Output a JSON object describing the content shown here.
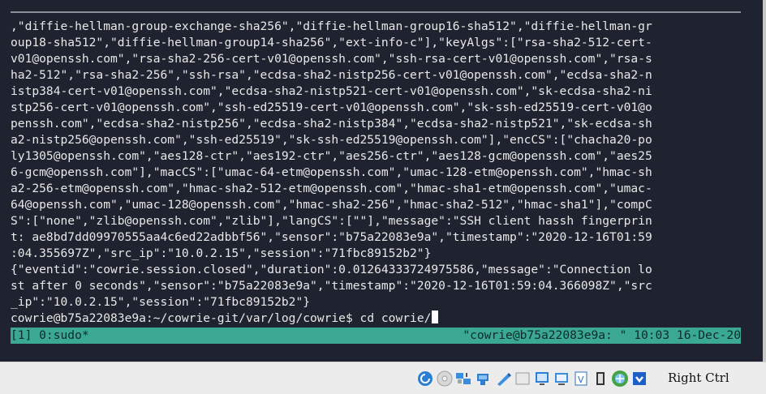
{
  "terminal": {
    "lines": [
      ",\"diffie-hellman-group-exchange-sha256\",\"diffie-hellman-group16-sha512\",\"diffie-hellman-gr",
      "oup18-sha512\",\"diffie-hellman-group14-sha256\",\"ext-info-c\"],\"keyAlgs\":[\"rsa-sha2-512-cert-",
      "v01@openssh.com\",\"rsa-sha2-256-cert-v01@openssh.com\",\"ssh-rsa-cert-v01@openssh.com\",\"rsa-s",
      "ha2-512\",\"rsa-sha2-256\",\"ssh-rsa\",\"ecdsa-sha2-nistp256-cert-v01@openssh.com\",\"ecdsa-sha2-n",
      "istp384-cert-v01@openssh.com\",\"ecdsa-sha2-nistp521-cert-v01@openssh.com\",\"sk-ecdsa-sha2-ni",
      "stp256-cert-v01@openssh.com\",\"ssh-ed25519-cert-v01@openssh.com\",\"sk-ssh-ed25519-cert-v01@o",
      "penssh.com\",\"ecdsa-sha2-nistp256\",\"ecdsa-sha2-nistp384\",\"ecdsa-sha2-nistp521\",\"sk-ecdsa-sh",
      "a2-nistp256@openssh.com\",\"ssh-ed25519\",\"sk-ssh-ed25519@openssh.com\"],\"encCS\":[\"chacha20-po",
      "ly1305@openssh.com\",\"aes128-ctr\",\"aes192-ctr\",\"aes256-ctr\",\"aes128-gcm@openssh.com\",\"aes25",
      "6-gcm@openssh.com\"],\"macCS\":[\"umac-64-etm@openssh.com\",\"umac-128-etm@openssh.com\",\"hmac-sh",
      "a2-256-etm@openssh.com\",\"hmac-sha2-512-etm@openssh.com\",\"hmac-sha1-etm@openssh.com\",\"umac-",
      "64@openssh.com\",\"umac-128@openssh.com\",\"hmac-sha2-256\",\"hmac-sha2-512\",\"hmac-sha1\"],\"compC",
      "S\":[\"none\",\"zlib@openssh.com\",\"zlib\"],\"langCS\":[\"\"],\"message\":\"SSH client hassh fingerprin",
      "t: ae8bd7dd09970555aa4c6ed22adbbf56\",\"sensor\":\"b75a22083e9a\",\"timestamp\":\"2020-12-16T01:59",
      ":04.355697Z\",\"src_ip\":\"10.0.2.15\",\"session\":\"71fbc89152b2\"}",
      "{\"eventid\":\"cowrie.session.closed\",\"duration\":0.01264333724975586,\"message\":\"Connection lo",
      "st after 0 seconds\",\"sensor\":\"b75a22083e9a\",\"timestamp\":\"2020-12-16T01:59:04.366098Z\",\"src",
      "_ip\":\"10.0.2.15\",\"session\":\"71fbc89152b2\"}"
    ],
    "prompt": "cowrie@b75a22083e9a:~/cowrie-git/var/log/cowrie$ ",
    "command": "cd cowrie/"
  },
  "status_bar": {
    "left": "[1] 0:sudo*",
    "right": "\"cowrie@b75a22083e9a: \" 10:03 16-Dec-20"
  },
  "vbox_bar": {
    "icons": [
      "optical-drive-icon",
      "cd-disc-icon",
      "network-icon",
      "usb-icon",
      "shared-folders-icon",
      "pencil-icon",
      "display-icon",
      "monitor-icon",
      "shared-clipboard-icon",
      "video-capture-icon",
      "mouse-integration-icon",
      "guest-additions-icon",
      "host-key-arrow-icon"
    ],
    "host_key": "Right Ctrl"
  },
  "colors": {
    "terminal_bg": "#1f2330",
    "terminal_fg": "#e8e8e8",
    "status_bar_bg": "#3aa892",
    "vbox_bar_bg": "#ececec"
  }
}
